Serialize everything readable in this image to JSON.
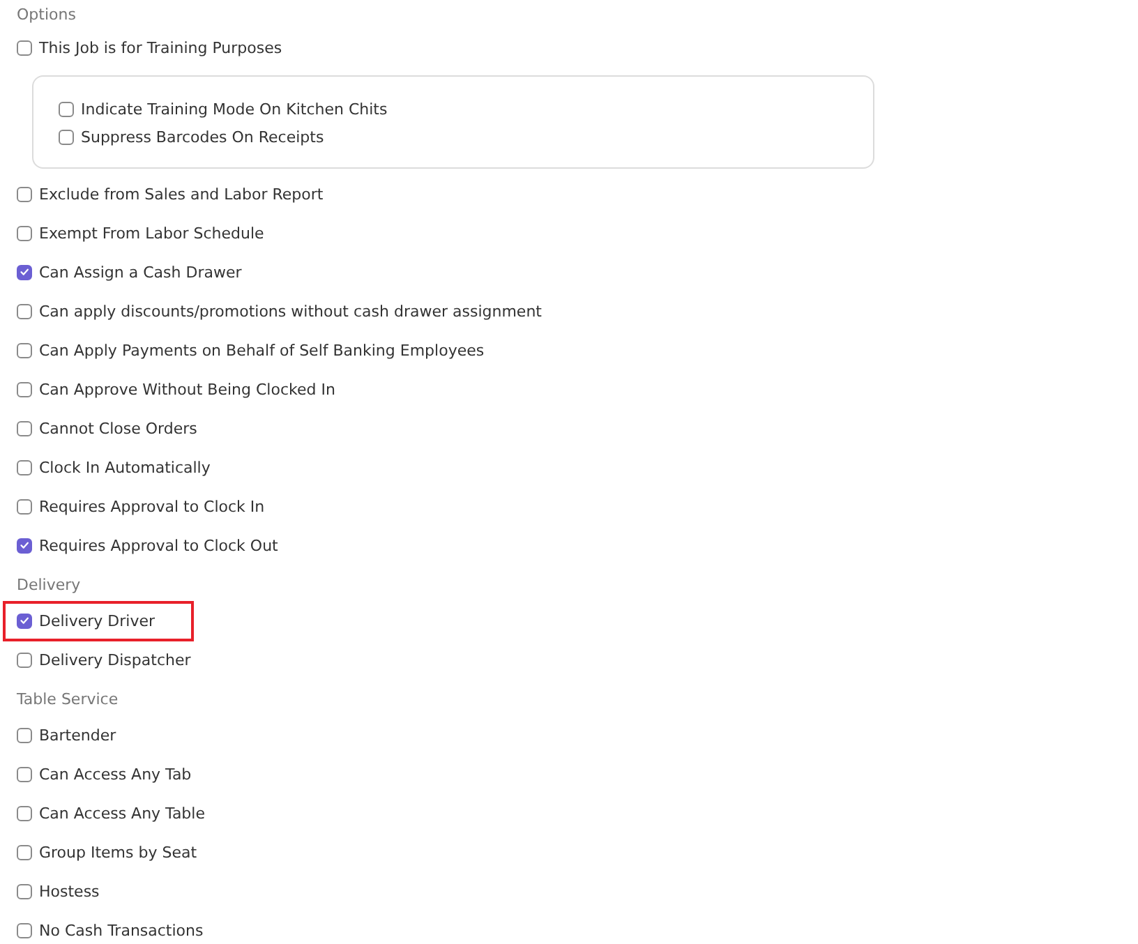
{
  "sections": [
    {
      "title": "Options",
      "items": [
        {
          "kind": "checkbox",
          "label": "This Job is for Training Purposes",
          "checked": false,
          "highlighted": false
        },
        {
          "kind": "group",
          "items": [
            {
              "label": "Indicate Training Mode On Kitchen Chits",
              "checked": false
            },
            {
              "label": "Suppress Barcodes On Receipts",
              "checked": false
            }
          ]
        },
        {
          "kind": "checkbox",
          "label": "Exclude from Sales and Labor Report",
          "checked": false,
          "highlighted": false
        },
        {
          "kind": "checkbox",
          "label": "Exempt From Labor Schedule",
          "checked": false,
          "highlighted": false
        },
        {
          "kind": "checkbox",
          "label": "Can Assign a Cash Drawer",
          "checked": true,
          "highlighted": false
        },
        {
          "kind": "checkbox",
          "label": "Can apply discounts/promotions without cash drawer assignment",
          "checked": false,
          "highlighted": false
        },
        {
          "kind": "checkbox",
          "label": "Can Apply Payments on Behalf of Self Banking Employees",
          "checked": false,
          "highlighted": false
        },
        {
          "kind": "checkbox",
          "label": "Can Approve Without Being Clocked In",
          "checked": false,
          "highlighted": false
        },
        {
          "kind": "checkbox",
          "label": "Cannot Close Orders",
          "checked": false,
          "highlighted": false
        },
        {
          "kind": "checkbox",
          "label": "Clock In Automatically",
          "checked": false,
          "highlighted": false
        },
        {
          "kind": "checkbox",
          "label": "Requires Approval to Clock In",
          "checked": false,
          "highlighted": false
        },
        {
          "kind": "checkbox",
          "label": "Requires Approval to Clock Out",
          "checked": true,
          "highlighted": false
        }
      ]
    },
    {
      "title": "Delivery",
      "items": [
        {
          "kind": "checkbox",
          "label": "Delivery Driver",
          "checked": true,
          "highlighted": true
        },
        {
          "kind": "checkbox",
          "label": "Delivery Dispatcher",
          "checked": false,
          "highlighted": false
        }
      ]
    },
    {
      "title": "Table Service",
      "items": [
        {
          "kind": "checkbox",
          "label": "Bartender",
          "checked": false,
          "highlighted": false
        },
        {
          "kind": "checkbox",
          "label": "Can Access Any Tab",
          "checked": false,
          "highlighted": false
        },
        {
          "kind": "checkbox",
          "label": "Can Access Any Table",
          "checked": false,
          "highlighted": false
        },
        {
          "kind": "checkbox",
          "label": "Group Items by Seat",
          "checked": false,
          "highlighted": false
        },
        {
          "kind": "checkbox",
          "label": "Hostess",
          "checked": false,
          "highlighted": false
        },
        {
          "kind": "checkbox",
          "label": "No Cash Transactions",
          "checked": false,
          "highlighted": false
        }
      ]
    }
  ]
}
